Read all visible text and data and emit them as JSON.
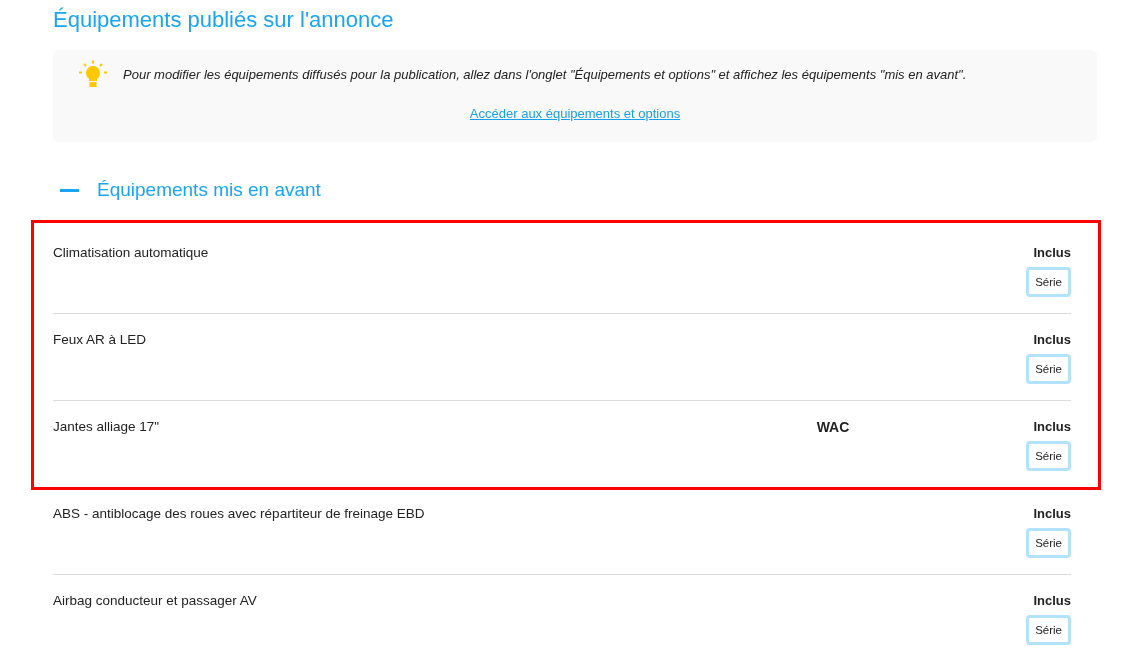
{
  "page_title": "Équipements publiés sur l'annonce",
  "info_box": {
    "message": "Pour modifier les équipements diffusés pour la publication, allez dans l'onglet \"Équipements et options\" et affichez les équipements \"mis en avant\".",
    "link": "Accéder aux équipements et options"
  },
  "section": {
    "title": "Équipements mis en avant",
    "expanded": true
  },
  "equipment": [
    {
      "label": "Climatisation automatique",
      "status": "Inclus",
      "badge": "Série",
      "highlighted": true
    },
    {
      "label": "Feux AR à LED",
      "status": "Inclus",
      "badge": "Série",
      "highlighted": true
    },
    {
      "label": "Jantes alliage 17\"",
      "column_2": "WAC",
      "status": "Inclus",
      "badge": "Série",
      "highlighted": true
    },
    {
      "label": "ABS - antiblocage des roues avec répartiteur de freinage EBD",
      "status": "Inclus",
      "badge": "Série",
      "highlighted": false
    },
    {
      "label": "Airbag conducteur et passager AV",
      "status": "Inclus",
      "badge": "Série",
      "highlighted": false
    }
  ]
}
